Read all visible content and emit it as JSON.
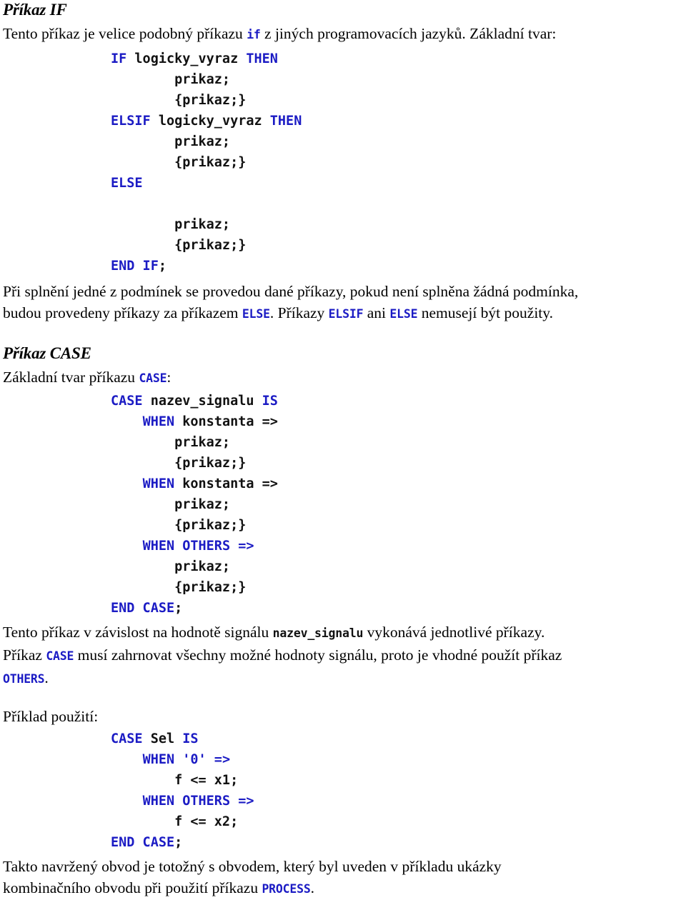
{
  "document": {
    "language": "cs",
    "colors": {
      "keyword_blue": "#1b1bc4",
      "body_text": "#000000",
      "background": "#ffffff"
    }
  },
  "sections": [
    {
      "heading": "Příkaz IF",
      "intro_paragraph": {
        "parts": [
          {
            "type": "text",
            "value": "Tento příkaz je velice podobný příkazu "
          },
          {
            "type": "keyword",
            "value": "if"
          },
          {
            "type": "text",
            "value": " z jiných programovacích jazyků. Základní tvar:"
          }
        ],
        "plain": "Tento příkaz je velice podobný příkazu if z jiných programovacích jazyků. Základní tvar:"
      },
      "code_block": {
        "name": "if-syntax-code",
        "lines": [
          "IF logicky_vyraz THEN",
          "        prikaz;",
          "        {prikaz;}",
          "ELSIF logicky_vyraz THEN",
          "        prikaz;",
          "        {prikaz;}",
          "ELSE",
          "",
          "        prikaz;",
          "        {prikaz;}",
          "END IF;"
        ]
      },
      "after_paragraph": {
        "plain": "Při splnění jedné z podmínek se provedou dané příkazy, pokud není splněna žádná podmínka, budou provedeny příkazy za příkazem ELSE. Příkazy ELSIF ani ELSE nemusejí být použity.",
        "line1_text": "Při splnění jedné z podmínek se provedou dané příkazy, pokud není splněna žádná podmínka,",
        "line2_a": "budou provedeny příkazy za příkazem ",
        "line2_kw1": "ELSE",
        "line2_b": ". Příkazy ",
        "line2_kw2": "ELSIF",
        "line2_c": " ani ",
        "line2_kw3": "ELSE",
        "line2_d": " nemusejí být použity."
      }
    },
    {
      "heading": "Příkaz CASE",
      "intro_paragraph": {
        "prefix": "Základní tvar příkazu ",
        "keyword": "CASE",
        "suffix": ":",
        "plain": "Základní tvar příkazu CASE:"
      },
      "code_block": {
        "name": "case-syntax-code",
        "lines": [
          "CASE nazev_signalu IS",
          "    WHEN konstanta =>",
          "        prikaz;",
          "        {prikaz;}",
          "    WHEN konstanta =>",
          "        prikaz;",
          "        {prikaz;}",
          "    WHEN OTHERS =>",
          "        prikaz;",
          "        {prikaz;}",
          "END CASE;"
        ]
      },
      "after_paragraph": {
        "plain": "Tento příkaz v závislost na hodnotě signálu nazev_signalu vykonává jednotlivé příkazy. Příkaz CASE musí zahrnovat všechny možné hodnoty signálu, proto je vhodné použít příkaz OTHERS.",
        "line1_a": "Tento příkaz v závislost na hodnotě signálu ",
        "line1_idf": "nazev_signalu",
        "line1_b": " vykonává jednotlivé příkazy.",
        "line2_a": "Příkaz ",
        "line2_kw": "CASE",
        "line2_b": " musí zahrnovat všechny možné hodnoty signálu, proto je vhodné použít příkaz",
        "line3_kw": "OTHERS",
        "line3_b": "."
      },
      "example_label": "Příklad použití:",
      "example_code_block": {
        "name": "case-example-code",
        "lines": [
          "CASE Sel IS",
          "    WHEN '0' =>",
          "        f <= x1;",
          "    WHEN OTHERS =>",
          "        f <= x2;",
          "END CASE;"
        ]
      },
      "closing_paragraph": {
        "plain": "Takto navržený obvod je totožný s obvodem, který byl uveden v příkladu ukázky kombinačního obvodu při použití příkazu PROCESS.",
        "line1": "Takto navržený obvod je totožný s obvodem, který byl uveden v příkladu ukázky",
        "line2_a": "kombinačního obvodu při použití příkazu ",
        "line2_kw": "PROCESS",
        "line2_b": "."
      }
    }
  ],
  "code_tokens": {
    "if_block": [
      [
        {
          "c": "k",
          "t": "IF"
        },
        {
          "c": "n",
          "t": " logicky_vyraz "
        },
        {
          "c": "k",
          "t": "THEN"
        }
      ],
      [
        {
          "c": "n",
          "t": "        prikaz;"
        }
      ],
      [
        {
          "c": "n",
          "t": "        {prikaz;}"
        }
      ],
      [
        {
          "c": "k",
          "t": "ELSIF"
        },
        {
          "c": "n",
          "t": " logicky_vyraz "
        },
        {
          "c": "k",
          "t": "THEN"
        }
      ],
      [
        {
          "c": "n",
          "t": "        prikaz;"
        }
      ],
      [
        {
          "c": "n",
          "t": "        {prikaz;}"
        }
      ],
      [
        {
          "c": "k",
          "t": "ELSE"
        }
      ],
      [
        {
          "c": "n",
          "t": ""
        }
      ],
      [
        {
          "c": "n",
          "t": "        prikaz;"
        }
      ],
      [
        {
          "c": "n",
          "t": "        {prikaz;}"
        }
      ],
      [
        {
          "c": "k",
          "t": "END IF"
        },
        {
          "c": "n",
          "t": ";"
        }
      ]
    ],
    "case_block": [
      [
        {
          "c": "k",
          "t": "CASE"
        },
        {
          "c": "n",
          "t": " nazev_signalu "
        },
        {
          "c": "k",
          "t": "IS"
        }
      ],
      [
        {
          "c": "n",
          "t": "    "
        },
        {
          "c": "k",
          "t": "WHEN"
        },
        {
          "c": "n",
          "t": " konstanta =>"
        }
      ],
      [
        {
          "c": "n",
          "t": "        prikaz;"
        }
      ],
      [
        {
          "c": "n",
          "t": "        {prikaz;}"
        }
      ],
      [
        {
          "c": "n",
          "t": "    "
        },
        {
          "c": "k",
          "t": "WHEN"
        },
        {
          "c": "n",
          "t": " konstanta =>"
        }
      ],
      [
        {
          "c": "n",
          "t": "        prikaz;"
        }
      ],
      [
        {
          "c": "n",
          "t": "        {prikaz;}"
        }
      ],
      [
        {
          "c": "n",
          "t": "    "
        },
        {
          "c": "k",
          "t": "WHEN OTHERS =>"
        }
      ],
      [
        {
          "c": "n",
          "t": "        prikaz;"
        }
      ],
      [
        {
          "c": "n",
          "t": "        {prikaz;}"
        }
      ],
      [
        {
          "c": "k",
          "t": "END CASE"
        },
        {
          "c": "n",
          "t": ";"
        }
      ]
    ],
    "example_block": [
      [
        {
          "c": "k",
          "t": "CASE"
        },
        {
          "c": "n",
          "t": " Sel "
        },
        {
          "c": "k",
          "t": "IS"
        }
      ],
      [
        {
          "c": "n",
          "t": "    "
        },
        {
          "c": "k",
          "t": "WHEN '0' =>"
        }
      ],
      [
        {
          "c": "n",
          "t": "        f <= x1;"
        }
      ],
      [
        {
          "c": "n",
          "t": "    "
        },
        {
          "c": "k",
          "t": "WHEN OTHERS =>"
        }
      ],
      [
        {
          "c": "n",
          "t": "        f <= x2;"
        }
      ],
      [
        {
          "c": "k",
          "t": "END CASE"
        },
        {
          "c": "n",
          "t": ";"
        }
      ]
    ]
  }
}
